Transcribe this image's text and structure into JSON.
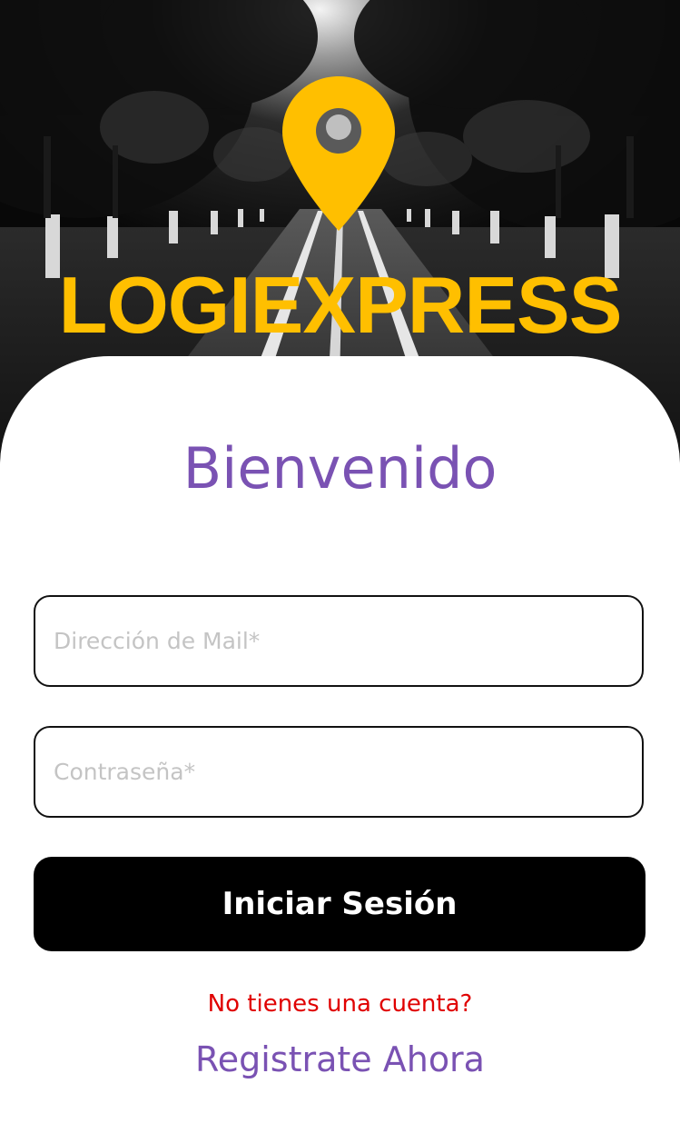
{
  "brand": {
    "name": "LOGIEXPRESS",
    "color": "#FFBF00"
  },
  "icons": {
    "logo": "map-pin-icon"
  },
  "login": {
    "welcome": "Bienvenido",
    "welcome_color": "#7A52B3",
    "email_placeholder": "Dirección de Mail*",
    "email_value": "",
    "password_placeholder": "Contraseña*",
    "password_value": "",
    "submit_label": "Iniciar Sesión",
    "no_account": "No tienes una cuenta?",
    "no_account_color": "#E00000",
    "register_label": "Registrate Ahora",
    "register_color": "#7A52B3"
  }
}
